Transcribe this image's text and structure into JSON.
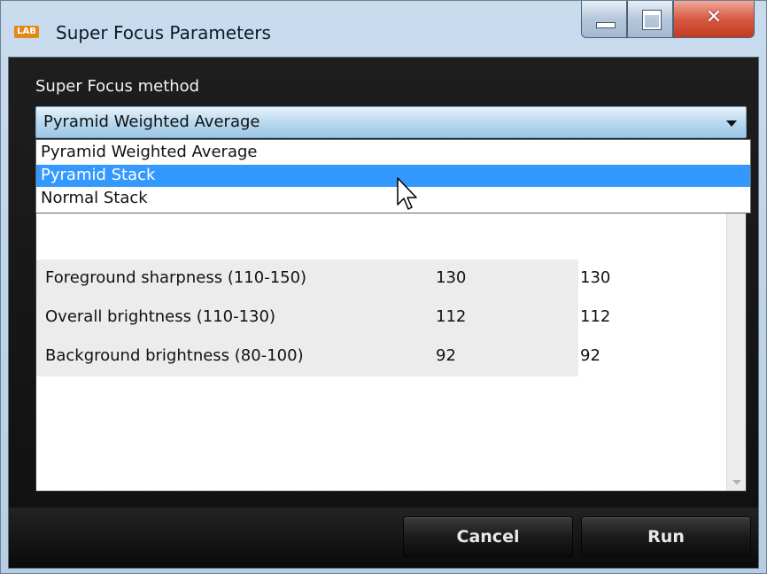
{
  "window": {
    "title": "Super Focus Parameters",
    "icon_text": "LAB",
    "accent_color": "#3399ff"
  },
  "method": {
    "label": "Super Focus method",
    "selected": "Pyramid Weighted Average",
    "options": [
      {
        "label": "Pyramid Weighted Average",
        "highlighted": false
      },
      {
        "label": "Pyramid Stack",
        "highlighted": true
      },
      {
        "label": "Normal Stack",
        "highlighted": false
      }
    ]
  },
  "parameters": [
    {
      "name": "Foreground sharpness (110-150)",
      "value1": "130",
      "value2": "130"
    },
    {
      "name": "Overall brightness (110-130)",
      "value1": "112",
      "value2": "112"
    },
    {
      "name": "Background brightness (80-100)",
      "value1": "92",
      "value2": "92"
    }
  ],
  "buttons": {
    "cancel": "Cancel",
    "run": "Run"
  }
}
